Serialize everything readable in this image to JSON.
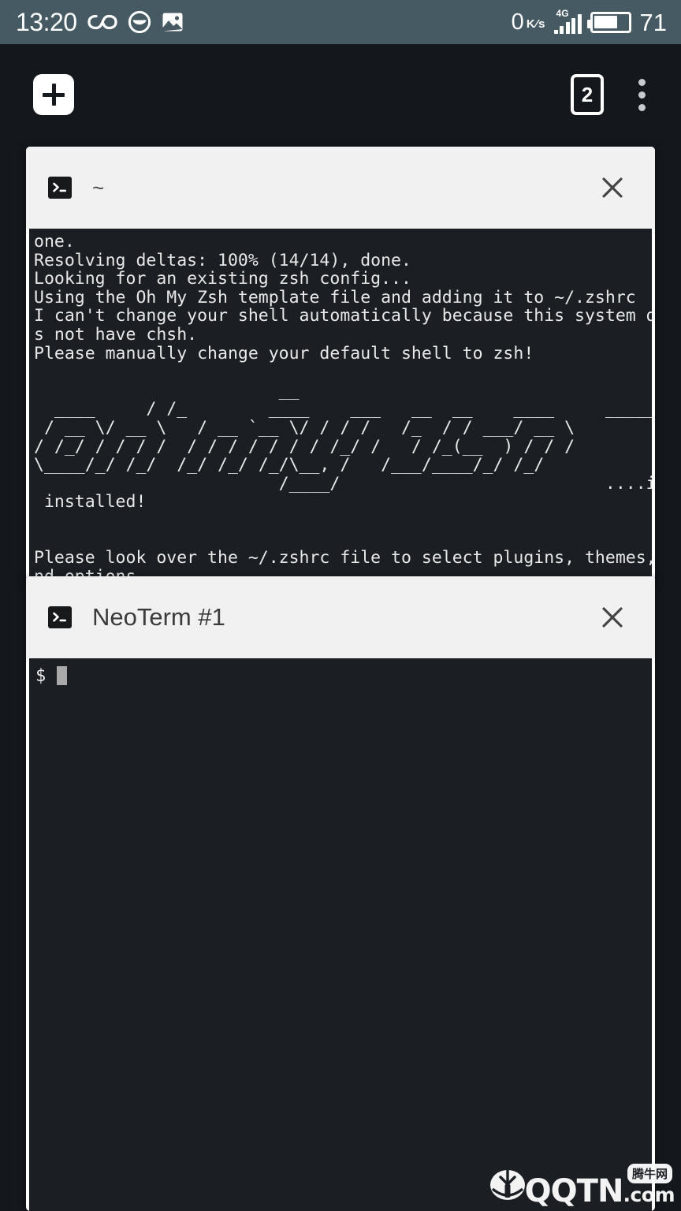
{
  "status_bar": {
    "clock": "13:20",
    "icons": [
      "infinity-icon",
      "face-icon",
      "photo-icon"
    ],
    "network_speed_value": "0",
    "network_speed_unit_num": "K",
    "network_speed_unit_den": "s",
    "network_type": "4G",
    "signal_bars_filled": 4,
    "signal_bars_total": 5,
    "battery_percent": "71",
    "battery_level_fraction": 0.71,
    "background_color": "#455a63",
    "foreground_color": "#ffffff"
  },
  "toolbar": {
    "new_session_label": "+",
    "session_count": "2",
    "overflow_label": "⋮",
    "background_color": "#14181c"
  },
  "sessions": [
    {
      "icon": "terminal-icon",
      "title": "~",
      "close_label": "✕",
      "terminal_text": "one.\nResolving deltas: 100% (14/14), done.\nLooking for an existing zsh config...\nUsing the Oh My Zsh template file and adding it to ~/.zshrc\nI can't change your shell automatically because this system doe\ns not have chsh.\nPlease manually change your default shell to zsh!\n\n                        __                                      __\n  ____     / /_        ____    ___   __  __    ____     _____/ /_\n / __ \\/ __ \\   / __ `__ \\/ / / /   /_  / / ___/ __ \\\n/ /_/ / / / /  / / / / / / / /_/ /   / /_(__  ) / / /\n\\____/_/ /_/  /_/ /_/ /_/\\__, /   /___/____/_/ /_/\n                        /____/                          ....is now\n installed!\n\n\nPlease look over the ~/.zshrc file to select plugins, themes, a\nnd options."
    },
    {
      "icon": "terminal-icon",
      "title": "NeoTerm #1",
      "close_label": "✕",
      "terminal_prompt": "$ ",
      "terminal_text": ""
    }
  ],
  "watermark": {
    "brand": "QQTN",
    "tld": ".com",
    "badge": "腾牛网"
  },
  "colors": {
    "app_background": "#14181c",
    "card_header": "#f1f1f1",
    "terminal_background": "#1b1f24",
    "terminal_text": "#e8e8e8",
    "accent_white": "#ffffff"
  }
}
